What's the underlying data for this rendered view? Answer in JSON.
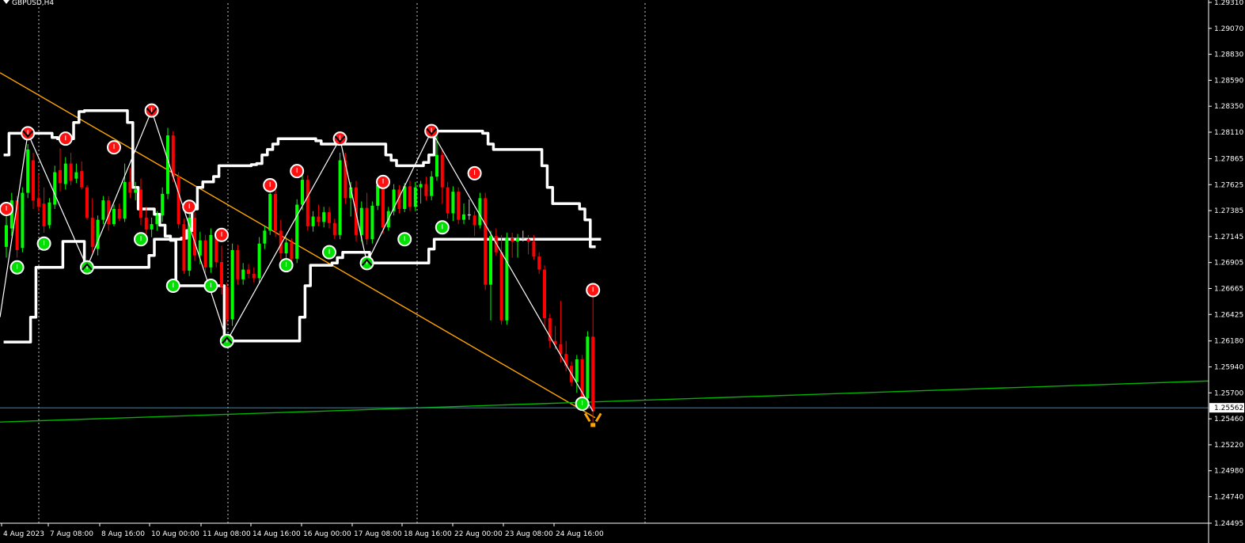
{
  "window": {
    "title": "GBPUSD,H4"
  },
  "colors": {
    "background": "#000000",
    "grid": "#c8c8c8",
    "axis": "#ffffff",
    "bull_candle": "#00ff00",
    "bear_candle": "#ff0000",
    "doji_candle": "#c8c8c8",
    "channel": "#ffffff",
    "zigzag": "#ffffff",
    "downtrend_line": "#ffa500",
    "uptrend_line": "#00b400",
    "current_price_line": "#2a8cc8",
    "signal_sell": "#ff1010",
    "signal_buy": "#00e000"
  },
  "chart_data": {
    "type": "candlestick",
    "symbol": "GBPUSD",
    "timeframe": "H4",
    "y_ticks": [
      "1.29310",
      "1.29070",
      "1.28830",
      "1.28590",
      "1.28350",
      "1.28110",
      "1.27865",
      "1.27625",
      "1.27385",
      "1.27145",
      "1.26905",
      "1.26665",
      "1.26425",
      "1.26180",
      "1.25940",
      "1.25700",
      "1.25460",
      "1.25220",
      "1.24980",
      "1.24740",
      "1.24495"
    ],
    "ylim": [
      1.24495,
      1.2931
    ],
    "current_price": "1.25562",
    "x_ticks": [
      "4 Aug 2023",
      "7 Aug 08:00",
      "8 Aug 16:00",
      "10 Aug 00:00",
      "11 Aug 08:00",
      "14 Aug 16:00",
      "16 Aug 00:00",
      "17 Aug 08:00",
      "18 Aug 16:00",
      "22 Aug 00:00",
      "23 Aug 08:00",
      "24 Aug 16:00"
    ],
    "candles": [
      [
        1.2705,
        1.2735,
        1.2695,
        1.2725
      ],
      [
        1.2722,
        1.2755,
        1.2715,
        1.2748
      ],
      [
        1.2748,
        1.2752,
        1.2695,
        1.2702
      ],
      [
        1.2704,
        1.276,
        1.27,
        1.2755
      ],
      [
        1.2755,
        1.28,
        1.275,
        1.2795
      ],
      [
        1.2785,
        1.2792,
        1.274,
        1.2748
      ],
      [
        1.275,
        1.2772,
        1.2738,
        1.2742
      ],
      [
        1.2745,
        1.276,
        1.2718,
        1.2724
      ],
      [
        1.2725,
        1.275,
        1.2722,
        1.2746
      ],
      [
        1.2744,
        1.278,
        1.274,
        1.2774
      ],
      [
        1.2776,
        1.2796,
        1.2756,
        1.2764
      ],
      [
        1.2763,
        1.2788,
        1.2758,
        1.2782
      ],
      [
        1.2782,
        1.2792,
        1.2762,
        1.2766
      ],
      [
        1.2768,
        1.2782,
        1.2764,
        1.2774
      ],
      [
        1.2775,
        1.2784,
        1.2758,
        1.276
      ],
      [
        1.276,
        1.2762,
        1.273,
        1.2732
      ],
      [
        1.2732,
        1.275,
        1.27,
        1.2705
      ],
      [
        1.2703,
        1.2734,
        1.2697,
        1.273
      ],
      [
        1.273,
        1.2752,
        1.2726,
        1.2748
      ],
      [
        1.2748,
        1.2752,
        1.272,
        1.2726
      ],
      [
        1.2726,
        1.2744,
        1.2724,
        1.274
      ],
      [
        1.274,
        1.2745,
        1.2729,
        1.2731
      ],
      [
        1.2731,
        1.2782,
        1.2728,
        1.2765
      ],
      [
        1.2765,
        1.2778,
        1.275,
        1.2755
      ],
      [
        1.2755,
        1.2765,
        1.2748,
        1.2758
      ],
      [
        1.2758,
        1.2768,
        1.2725,
        1.2732
      ],
      [
        1.2732,
        1.2742,
        1.2717,
        1.2721
      ],
      [
        1.2721,
        1.2732,
        1.2714,
        1.2726
      ],
      [
        1.2726,
        1.2738,
        1.272,
        1.2734
      ],
      [
        1.2734,
        1.276,
        1.2728,
        1.2754
      ],
      [
        1.2754,
        1.2815,
        1.2749,
        1.2808
      ],
      [
        1.2808,
        1.2812,
        1.2765,
        1.277
      ],
      [
        1.277,
        1.2774,
        1.2722,
        1.2726
      ],
      [
        1.2726,
        1.2731,
        1.268,
        1.2683
      ],
      [
        1.2683,
        1.2738,
        1.2678,
        1.2732
      ],
      [
        1.2732,
        1.2737,
        1.2692,
        1.2697
      ],
      [
        1.2697,
        1.2719,
        1.2689,
        1.2711
      ],
      [
        1.2711,
        1.2716,
        1.2681,
        1.2686
      ],
      [
        1.2686,
        1.2722,
        1.2681,
        1.2716
      ],
      [
        1.2716,
        1.272,
        1.2686,
        1.2691
      ],
      [
        1.2691,
        1.2706,
        1.2661,
        1.2668
      ],
      [
        1.2668,
        1.2672,
        1.2633,
        1.2638
      ],
      [
        1.2638,
        1.2708,
        1.2632,
        1.2702
      ],
      [
        1.2702,
        1.2707,
        1.267,
        1.2675
      ],
      [
        1.2675,
        1.269,
        1.267,
        1.2684
      ],
      [
        1.2684,
        1.2689,
        1.2676,
        1.268
      ],
      [
        1.268,
        1.2686,
        1.2672,
        1.2676
      ],
      [
        1.2676,
        1.2714,
        1.2671,
        1.2708
      ],
      [
        1.2708,
        1.2724,
        1.2703,
        1.272
      ],
      [
        1.272,
        1.2759,
        1.2716,
        1.2754
      ],
      [
        1.2754,
        1.2759,
        1.2714,
        1.272
      ],
      [
        1.272,
        1.273,
        1.2694,
        1.2699
      ],
      [
        1.2699,
        1.2714,
        1.2692,
        1.2709
      ],
      [
        1.2709,
        1.2713,
        1.2689,
        1.2694
      ],
      [
        1.2694,
        1.2749,
        1.269,
        1.2744
      ],
      [
        1.2744,
        1.2772,
        1.2739,
        1.2767
      ],
      [
        1.2767,
        1.2771,
        1.272,
        1.2724
      ],
      [
        1.2724,
        1.2738,
        1.2719,
        1.2733
      ],
      [
        1.2733,
        1.2744,
        1.2724,
        1.2728
      ],
      [
        1.2728,
        1.2742,
        1.2723,
        1.2737
      ],
      [
        1.2737,
        1.2742,
        1.2722,
        1.2727
      ],
      [
        1.2727,
        1.2731,
        1.2712,
        1.2716
      ],
      [
        1.2716,
        1.2792,
        1.2712,
        1.2785
      ],
      [
        1.2785,
        1.2792,
        1.2745,
        1.275
      ],
      [
        1.275,
        1.2765,
        1.2733,
        1.276
      ],
      [
        1.276,
        1.2766,
        1.271,
        1.2716
      ],
      [
        1.2716,
        1.2747,
        1.271,
        1.2741
      ],
      [
        1.2741,
        1.2755,
        1.2707,
        1.2712
      ],
      [
        1.2712,
        1.2747,
        1.2708,
        1.2743
      ],
      [
        1.2743,
        1.2767,
        1.2739,
        1.2762
      ],
      [
        1.2762,
        1.2766,
        1.2717,
        1.2723
      ],
      [
        1.2723,
        1.2742,
        1.272,
        1.2738
      ],
      [
        1.2738,
        1.2763,
        1.2734,
        1.2758
      ],
      [
        1.2758,
        1.2762,
        1.2736,
        1.274
      ],
      [
        1.274,
        1.2764,
        1.2737,
        1.2761
      ],
      [
        1.2761,
        1.2766,
        1.2738,
        1.2742
      ],
      [
        1.2742,
        1.2765,
        1.2738,
        1.276
      ],
      [
        1.276,
        1.2766,
        1.2745,
        1.2763
      ],
      [
        1.2763,
        1.277,
        1.2748,
        1.2752
      ],
      [
        1.2752,
        1.2775,
        1.2748,
        1.277
      ],
      [
        1.277,
        1.2808,
        1.2766,
        1.279
      ],
      [
        1.279,
        1.2794,
        1.2745,
        1.276
      ],
      [
        1.276,
        1.2765,
        1.2731,
        1.2736
      ],
      [
        1.2736,
        1.2761,
        1.2729,
        1.2756
      ],
      [
        1.2756,
        1.276,
        1.2726,
        1.273
      ],
      [
        1.273,
        1.2745,
        1.2726,
        1.2735
      ],
      [
        1.2735,
        1.2749,
        1.273,
        1.2734
      ],
      [
        1.2734,
        1.2738,
        1.2715,
        1.2725
      ],
      [
        1.2725,
        1.2755,
        1.2722,
        1.275
      ],
      [
        1.275,
        1.2755,
        1.2665,
        1.267
      ],
      [
        1.267,
        1.272,
        1.2637,
        1.2715
      ],
      [
        1.2715,
        1.2722,
        1.2697,
        1.27
      ],
      [
        1.27,
        1.2716,
        1.2633,
        1.2637
      ],
      [
        1.2637,
        1.2718,
        1.2633,
        1.2713
      ],
      [
        1.2713,
        1.2718,
        1.2695,
        1.271
      ],
      [
        1.271,
        1.2717,
        1.2695,
        1.2713
      ],
      [
        1.2713,
        1.272,
        1.271,
        1.2712
      ],
      [
        1.2712,
        1.2716,
        1.2698,
        1.271
      ],
      [
        1.271,
        1.2716,
        1.2693,
        1.2696
      ],
      [
        1.2696,
        1.27,
        1.268,
        1.2684
      ],
      [
        1.2684,
        1.2688,
        1.263,
        1.2639
      ],
      [
        1.2639,
        1.2643,
        1.2612,
        1.2618
      ],
      [
        1.2618,
        1.2632,
        1.261,
        1.2615
      ],
      [
        1.2615,
        1.2655,
        1.2598,
        1.2606
      ],
      [
        1.2606,
        1.2618,
        1.259,
        1.2595
      ],
      [
        1.2595,
        1.2599,
        1.2576,
        1.258
      ],
      [
        1.258,
        1.2605,
        1.257,
        1.2601
      ],
      [
        1.2601,
        1.2605,
        1.256,
        1.2565
      ],
      [
        1.2565,
        1.2627,
        1.256,
        1.2622
      ],
      [
        1.2622,
        1.2665,
        1.254,
        1.2553
      ]
    ],
    "signals": [
      {
        "i": 0,
        "type": "sell",
        "price": 1.274
      },
      {
        "i": 2,
        "type": "buy",
        "price": 1.2686
      },
      {
        "i": 4,
        "type": "sell",
        "price": 1.281,
        "pivot": true
      },
      {
        "i": 7,
        "type": "buy",
        "price": 1.2708
      },
      {
        "i": 11,
        "type": "sell",
        "price": 1.2805
      },
      {
        "i": 15,
        "type": "buy",
        "price": 1.2686,
        "pivot": true
      },
      {
        "i": 20,
        "type": "sell",
        "price": 1.2797
      },
      {
        "i": 25,
        "type": "buy",
        "price": 1.2712
      },
      {
        "i": 27,
        "type": "sell",
        "price": 1.2831,
        "pivot": true
      },
      {
        "i": 31,
        "type": "buy",
        "price": 1.2669
      },
      {
        "i": 34,
        "type": "sell",
        "price": 1.2742
      },
      {
        "i": 38,
        "type": "buy",
        "price": 1.2669
      },
      {
        "i": 40,
        "type": "sell",
        "price": 1.2716
      },
      {
        "i": 41,
        "type": "buy",
        "price": 1.2618,
        "pivot": true
      },
      {
        "i": 49,
        "type": "sell",
        "price": 1.2762
      },
      {
        "i": 52,
        "type": "buy",
        "price": 1.2688
      },
      {
        "i": 54,
        "type": "sell",
        "price": 1.2775
      },
      {
        "i": 60,
        "type": "buy",
        "price": 1.27
      },
      {
        "i": 62,
        "type": "sell",
        "price": 1.2805,
        "pivot": true
      },
      {
        "i": 67,
        "type": "buy",
        "price": 1.269,
        "pivot": true
      },
      {
        "i": 70,
        "type": "sell",
        "price": 1.2765
      },
      {
        "i": 74,
        "type": "buy",
        "price": 1.2712
      },
      {
        "i": 79,
        "type": "sell",
        "price": 1.2812,
        "pivot": true
      },
      {
        "i": 81,
        "type": "buy",
        "price": 1.2723
      },
      {
        "i": 87,
        "type": "sell",
        "price": 1.2773
      },
      {
        "i": 107,
        "type": "buy",
        "price": 1.256
      },
      {
        "i": 109,
        "type": "sell",
        "price": 1.2665
      }
    ],
    "channel_upper": [
      1.279,
      1.281,
      1.281,
      1.281,
      1.281,
      1.281,
      1.281,
      1.281,
      1.281,
      1.2806,
      1.2805,
      1.2805,
      1.2805,
      1.282,
      1.283,
      1.2831,
      1.2831,
      1.2831,
      1.2831,
      1.2831,
      1.2831,
      1.2831,
      1.2831,
      1.282,
      1.276,
      1.274,
      1.274,
      1.274,
      1.2735,
      1.2725,
      1.2715,
      1.2711,
      1.2712,
      1.2713,
      1.272,
      1.274,
      1.276,
      1.2765,
      1.2765,
      1.277,
      1.278,
      1.278,
      1.278,
      1.278,
      1.278,
      1.278,
      1.2781,
      1.2782,
      1.279,
      1.2795,
      1.28,
      1.2805,
      1.2805,
      1.2805,
      1.2805,
      1.2805,
      1.2805,
      1.2805,
      1.2803,
      1.28,
      1.28,
      1.28,
      1.28,
      1.28,
      1.28,
      1.28,
      1.28,
      1.28,
      1.28,
      1.28,
      1.28,
      1.279,
      1.2785,
      1.278,
      1.278,
      1.278,
      1.278,
      1.278,
      1.2783,
      1.279,
      1.2812,
      1.2812,
      1.2812,
      1.2812,
      1.2812,
      1.2812,
      1.2812,
      1.2812,
      1.2812,
      1.281,
      1.28,
      1.2795,
      1.2795,
      1.2795,
      1.2795,
      1.2795,
      1.2795,
      1.2795,
      1.2795,
      1.2795,
      1.278,
      1.276,
      1.2745,
      1.2745,
      1.2745,
      1.2745,
      1.2745,
      1.274,
      1.273,
      1.2705
    ],
    "channel_lower": [
      1.2617,
      1.2617,
      1.2617,
      1.2617,
      1.2617,
      1.264,
      1.2686,
      1.2686,
      1.2686,
      1.2686,
      1.2686,
      1.271,
      1.271,
      1.271,
      1.271,
      1.2686,
      1.2686,
      1.2686,
      1.2686,
      1.2686,
      1.2686,
      1.2686,
      1.2686,
      1.2686,
      1.2686,
      1.2686,
      1.2686,
      1.2697,
      1.2712,
      1.2712,
      1.2712,
      1.2712,
      1.2669,
      1.2669,
      1.2669,
      1.2669,
      1.2669,
      1.2669,
      1.2669,
      1.2669,
      1.2669,
      1.2618,
      1.2618,
      1.2618,
      1.2618,
      1.2618,
      1.2618,
      1.2618,
      1.2618,
      1.2618,
      1.2618,
      1.2618,
      1.2618,
      1.2618,
      1.2618,
      1.264,
      1.2669,
      1.2688,
      1.2688,
      1.2688,
      1.2688,
      1.269,
      1.2695,
      1.27,
      1.27,
      1.27,
      1.27,
      1.27,
      1.269,
      1.269,
      1.269,
      1.269,
      1.269,
      1.269,
      1.269,
      1.269,
      1.269,
      1.269,
      1.269,
      1.2703,
      1.2712,
      1.2712,
      1.2712,
      1.2712,
      1.2712,
      1.2712,
      1.2712,
      1.2712,
      1.2712,
      1.2712,
      1.2712,
      1.2712,
      1.2712,
      1.2712,
      1.2712,
      1.2712,
      1.2712,
      1.2712,
      1.2712,
      1.2712,
      1.2712,
      1.2712,
      1.2712,
      1.2712,
      1.2712,
      1.2712,
      1.2712,
      1.2712,
      1.2712,
      1.2712,
      1.2712
    ]
  }
}
